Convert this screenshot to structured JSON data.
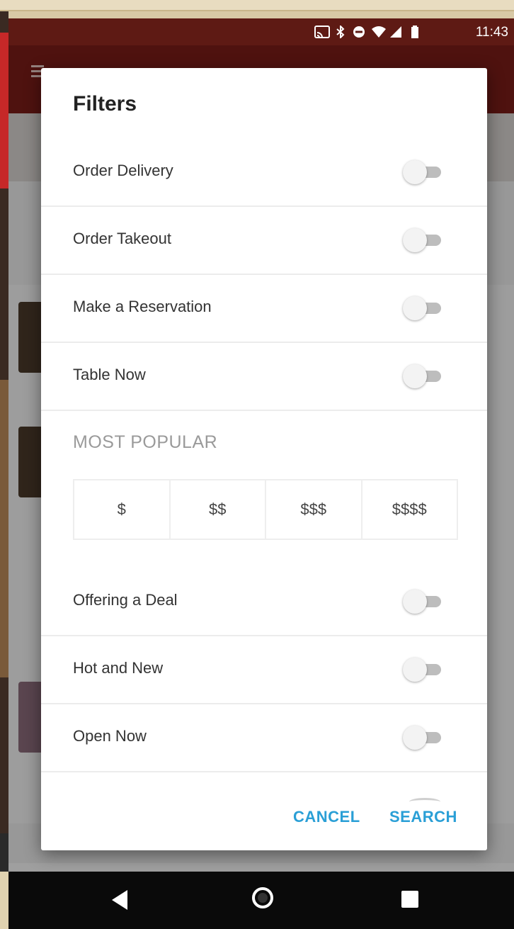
{
  "status_bar": {
    "time": "11:43",
    "icons": [
      "cast-icon",
      "bluetooth-icon",
      "do-not-disturb-icon",
      "wifi-icon",
      "signal-icon",
      "battery-icon"
    ]
  },
  "dialog": {
    "title": "Filters",
    "toggles_top": [
      {
        "label": "Order Delivery",
        "on": false
      },
      {
        "label": "Order Takeout",
        "on": false
      },
      {
        "label": "Make a Reservation",
        "on": false
      },
      {
        "label": "Table Now",
        "on": false
      }
    ],
    "section_label": "MOST POPULAR",
    "prices": [
      "$",
      "$$",
      "$$$",
      "$$$$"
    ],
    "toggles_bottom": [
      {
        "label": "Offering a Deal",
        "on": false
      },
      {
        "label": "Hot and New",
        "on": false
      },
      {
        "label": "Open Now",
        "on": false
      }
    ],
    "cancel_label": "CANCEL",
    "search_label": "SEARCH"
  },
  "colors": {
    "accent": "#2a9fd6",
    "app_bar": "#7a1c17",
    "status_bar": "#5e1a14",
    "toggle_track": "#bdbdbd"
  }
}
